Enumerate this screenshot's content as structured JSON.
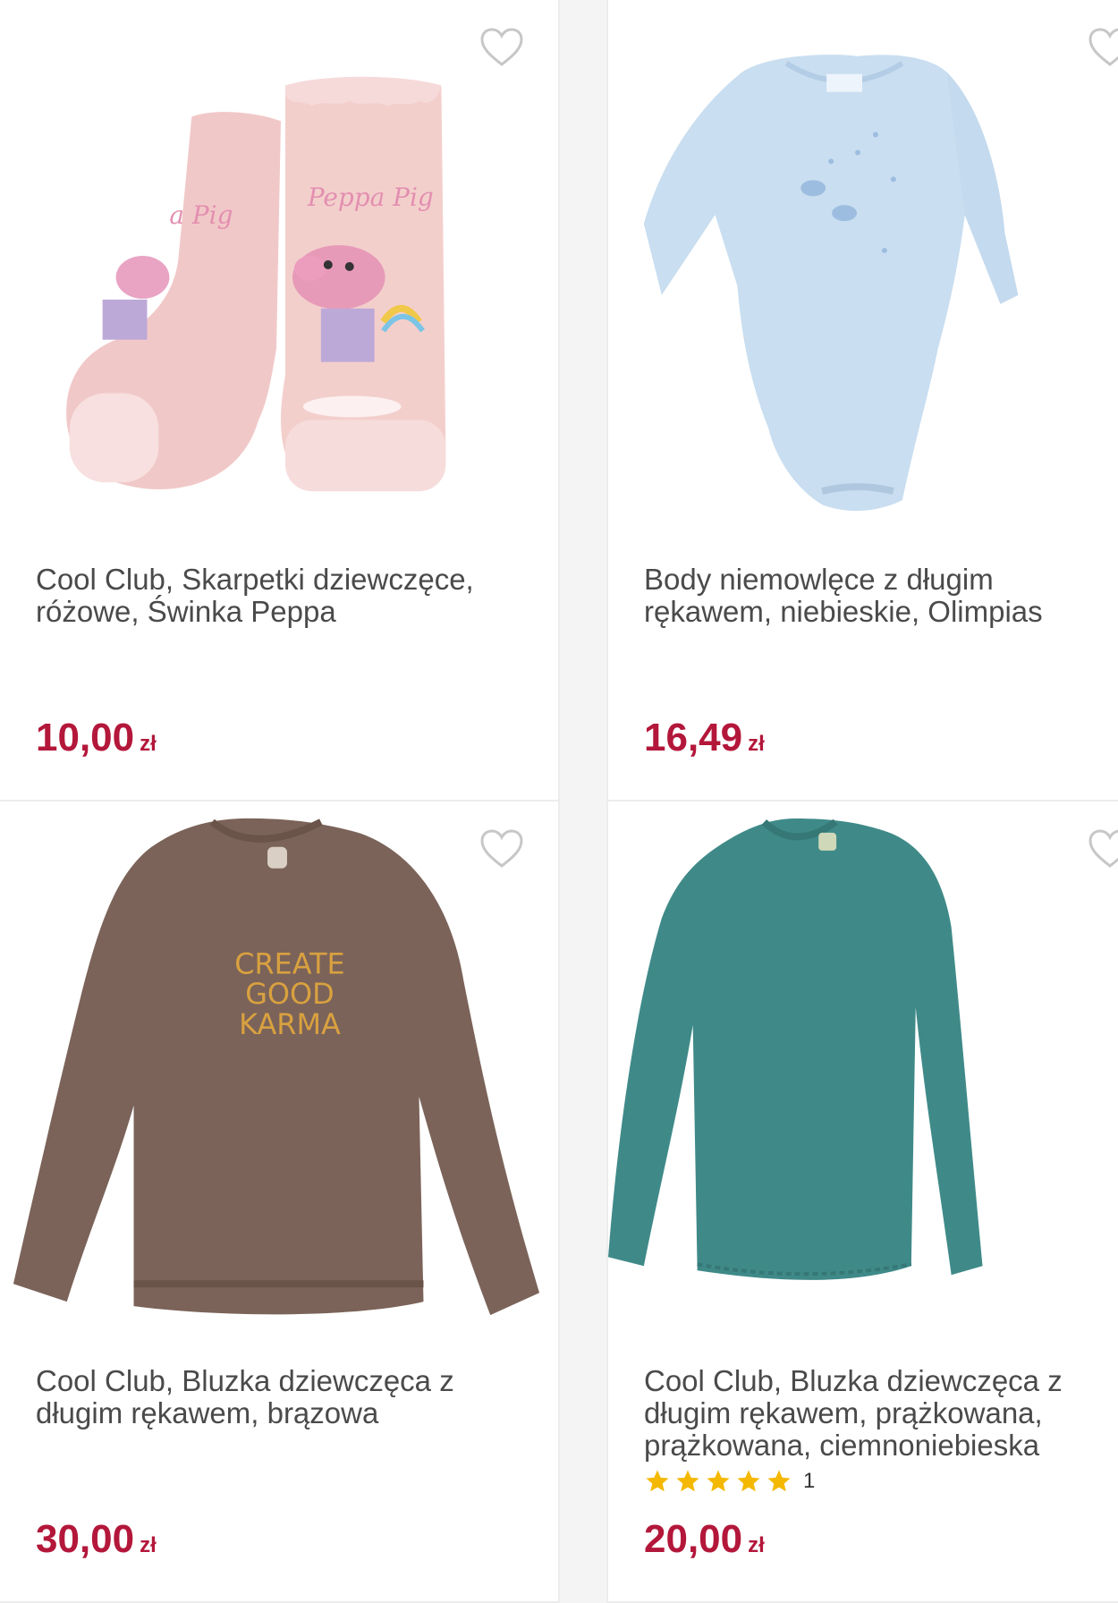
{
  "products": [
    {
      "title": "Cool Club, Skarpetki dziewczęce, różowe, Świnka Peppa",
      "price": "10,00",
      "currency": "zł",
      "image_icon": "pink-peppa-socks-image",
      "print_text": "Peppa Pig"
    },
    {
      "title": "Body niemowlęce z długim rękawem, niebieskie, Olimpias",
      "price": "16,49",
      "currency": "zł",
      "image_icon": "blue-baby-bodysuit-image"
    },
    {
      "title": "Cool Club, Bluzka dziewczęca z długim rękawem, brązowa",
      "price": "30,00",
      "currency": "zł",
      "image_icon": "brown-sweatshirt-image",
      "print_lines": [
        "CREATE",
        "GOOD",
        "KARMA"
      ]
    },
    {
      "title": "Cool Club, Bluzka dziewczęca z długim rękawem, prążkowana, prążkowana, ciemnoniebieska",
      "price": "20,00",
      "currency": "zł",
      "image_icon": "teal-ribbed-top-image",
      "rating": {
        "stars": 5,
        "count": "1"
      }
    }
  ],
  "colors": {
    "price": "#b3173a",
    "star": "#f5b800",
    "title": "#4a4a4a"
  }
}
